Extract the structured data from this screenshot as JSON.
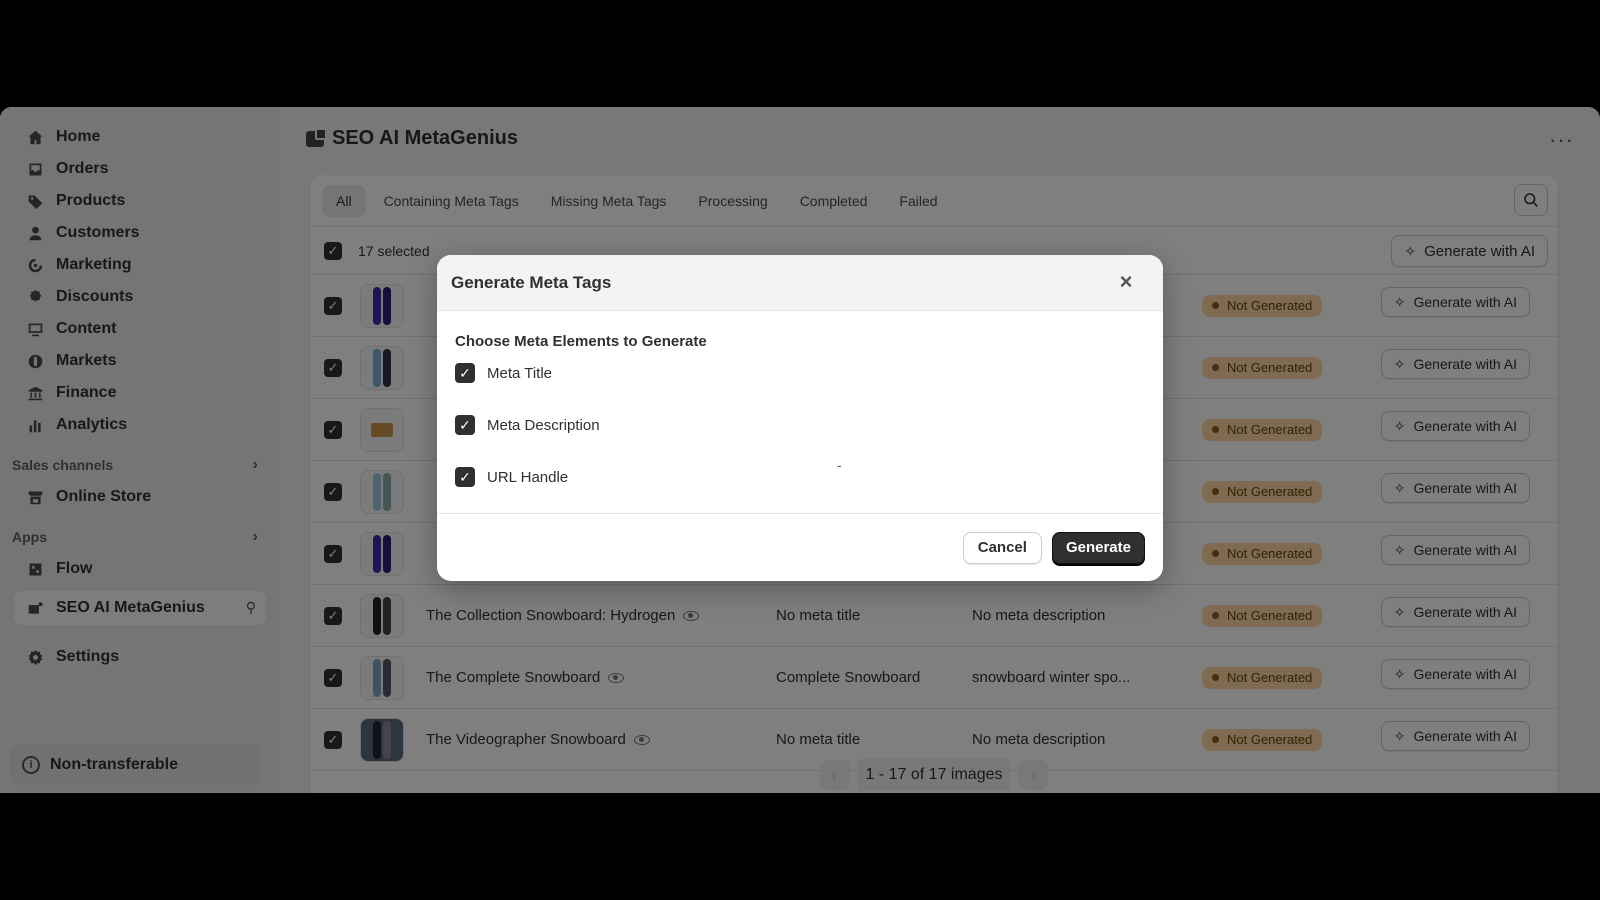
{
  "sidebar": {
    "items": [
      {
        "label": "Home",
        "icon": "home-icon"
      },
      {
        "label": "Orders",
        "icon": "inbox-icon"
      },
      {
        "label": "Products",
        "icon": "tag-icon"
      },
      {
        "label": "Customers",
        "icon": "person-icon"
      },
      {
        "label": "Marketing",
        "icon": "target-icon"
      },
      {
        "label": "Discounts",
        "icon": "discount-icon"
      },
      {
        "label": "Content",
        "icon": "content-icon"
      },
      {
        "label": "Markets",
        "icon": "globe-icon"
      },
      {
        "label": "Finance",
        "icon": "bank-icon"
      },
      {
        "label": "Analytics",
        "icon": "chart-icon"
      }
    ],
    "sales_channels_label": "Sales channels",
    "online_store_label": "Online Store",
    "apps_label": "Apps",
    "flow_label": "Flow",
    "active_app_label": "SEO AI MetaGenius",
    "settings_label": "Settings",
    "nontransferable_label": "Non-transferable"
  },
  "header": {
    "title": "SEO AI MetaGenius"
  },
  "tabs": [
    "All",
    "Containing Meta Tags",
    "Missing Meta Tags",
    "Processing",
    "Completed",
    "Failed"
  ],
  "bulk": {
    "selected_label": "17 selected",
    "generate_label": "Generate with AI"
  },
  "rows": [
    {
      "name": "",
      "meta_title": "",
      "meta_desc": "",
      "status": "Not Generated",
      "action": "Generate with AI"
    },
    {
      "name": "",
      "meta_title": "",
      "meta_desc": "",
      "status": "Not Generated",
      "action": "Generate with AI"
    },
    {
      "name": "",
      "meta_title": "",
      "meta_desc": "",
      "status": "Not Generated",
      "action": "Generate with AI"
    },
    {
      "name": "",
      "meta_title": "",
      "meta_desc": "",
      "status": "Not Generated",
      "action": "Generate with AI"
    },
    {
      "name": "",
      "meta_title": "",
      "meta_desc": "",
      "status": "Not Generated",
      "action": "Generate with AI"
    },
    {
      "name": "The Collection Snowboard: Hydrogen",
      "meta_title": "No meta title",
      "meta_desc": "No meta description",
      "status": "Not Generated",
      "action": "Generate with AI"
    },
    {
      "name": "The Complete Snowboard",
      "meta_title": "Complete Snowboard",
      "meta_desc": "snowboard winter spo...",
      "status": "Not Generated",
      "action": "Generate with AI"
    },
    {
      "name": "The Videographer Snowboard",
      "meta_title": "No meta title",
      "meta_desc": "No meta description",
      "status": "Not Generated",
      "action": "Generate with AI"
    }
  ],
  "pager": {
    "text": "1 - 17 of 17 images"
  },
  "modal": {
    "title": "Generate Meta Tags",
    "section_label": "Choose Meta Elements to Generate",
    "options": [
      "Meta Title",
      "Meta Description",
      "URL Handle"
    ],
    "dash": "-",
    "cancel_label": "Cancel",
    "generate_label": "Generate"
  },
  "colors": {
    "badge_bg": "#ffd6a4",
    "primary_button": "#303030"
  }
}
